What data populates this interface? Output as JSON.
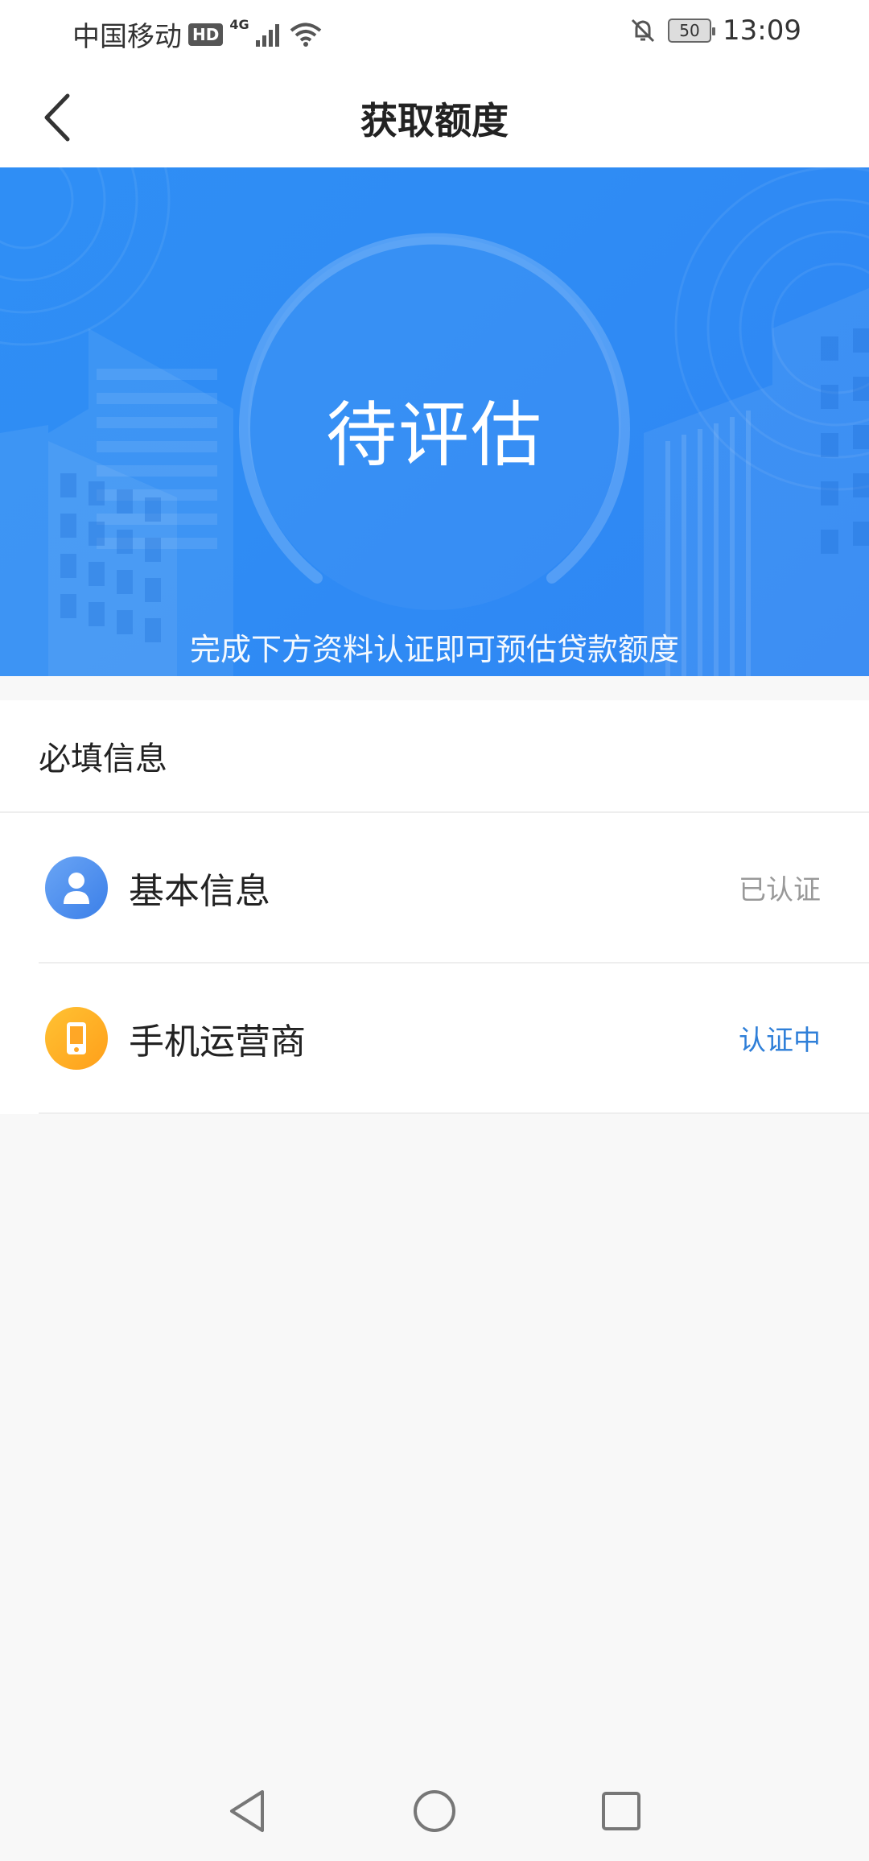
{
  "status_bar": {
    "carrier": "中国移动",
    "hd": "HD",
    "network": "4G",
    "battery": "50",
    "time": "13:09"
  },
  "nav": {
    "title": "获取额度"
  },
  "hero": {
    "status": "待评估",
    "subtitle": "完成下方资料认证即可预估贷款额度"
  },
  "section": {
    "title": "必填信息",
    "items": [
      {
        "label": "基本信息",
        "status": "已认证",
        "icon": "user-icon"
      },
      {
        "label": "手机运营商",
        "status": "认证中",
        "icon": "phone-icon"
      }
    ]
  },
  "colors": {
    "accent": "#2f8cf4",
    "pending": "#2f7fd8",
    "done": "#999999",
    "orange": "#ffa726"
  }
}
